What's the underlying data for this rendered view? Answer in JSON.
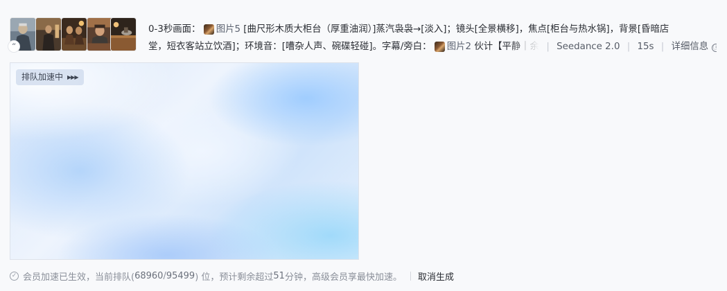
{
  "references": {
    "thumbnails": [
      {
        "name": "reference-image-1"
      },
      {
        "name": "reference-image-2"
      },
      {
        "name": "reference-image-3"
      },
      {
        "name": "reference-image-4"
      },
      {
        "name": "reference-image-5"
      }
    ],
    "quote_icon": "quote-icon"
  },
  "prompt": {
    "line1_prefix": "0-3秒画面：",
    "ref1_label": "图片5",
    "line1_rest": "[曲尺形木质大柜台（厚重油润）]蒸汽袅袅→[淡入]；镜头[全景横移]，焦点[柜台与热水锅]，背景[昏暗店",
    "line2_text": "堂，短衣客站立饮酒]；环境音：[嘈杂人声、碗碟轻碰]。字幕/旁白：",
    "ref2_label": "图片2",
    "line2_tail": "伙计【平静｜余",
    "model": "Seedance 2.0",
    "duration": "15s",
    "details_label": "详细信息",
    "info_icon": "ⓘ"
  },
  "video": {
    "queue_label": "排队加速中",
    "queue_arrows": "▶▶▶"
  },
  "footer": {
    "status_prefix": "会员加速已生效，当前排队(",
    "queue_position": "68960",
    "queue_slash": "/",
    "queue_total": "95499",
    "status_mid": ") 位，预计剩余超过 ",
    "minutes": "51",
    "status_suffix": " 分钟，高级会员享最快加速。",
    "cancel_label": "取消生成"
  },
  "colors": {
    "background": "#f8f9fb",
    "text": "#2a2d33",
    "muted": "#8a8f99"
  }
}
